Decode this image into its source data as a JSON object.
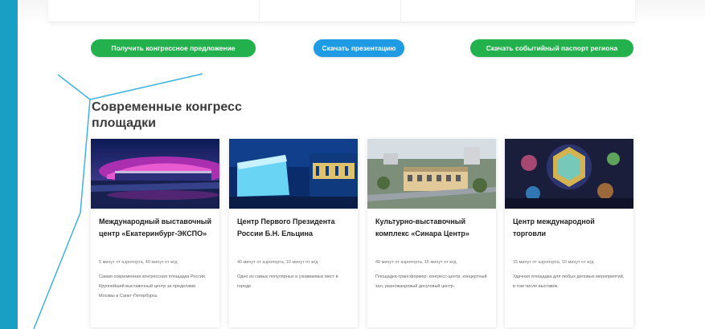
{
  "buttons": {
    "congress_offer": "Получить конгрессное предложение",
    "presentation": "Скачать презентацию",
    "event_passport": "Скачать событийный паспорт региона"
  },
  "section": {
    "title": "Современные конгресс площадки"
  },
  "venues": [
    {
      "title": "Международный выставочный центр «Екатеринбург-ЭКСПО»",
      "meta": "5 минут от аэропорта, 40 минут от ж/д",
      "description": "Самая современная конгрессная площадка России. Крупнейший выставочный центр за пределами Москвы и Санкт-Петербурга."
    },
    {
      "title": "Центр Первого Президента России Б.Н. Ельцина",
      "meta": "40 минут от аэропорта, 10 минут от ж/д",
      "description": "Одно из самых популярных и узнаваемых мест в городе."
    },
    {
      "title": "Культурно-выставочный комплекс «Синара Центр»",
      "meta": "40 минут от аэропорта, 15 минут от ж/д",
      "description": "Площадка-трансформер: конгресс-центр, концертный зал, разножанровый досуговый центр."
    },
    {
      "title": "Центр международной торговли",
      "meta": "15 минут от аэропорта, 10 минут от ж/д",
      "description": "Удачная площадка для любых деловых мероприятий, в том числе выставок."
    }
  ],
  "colors": {
    "green_button": "#22b14c",
    "blue_button": "#1e9be3",
    "accent_stripe": "#1a9fc4",
    "deco_lines": "#3fb2e0"
  }
}
